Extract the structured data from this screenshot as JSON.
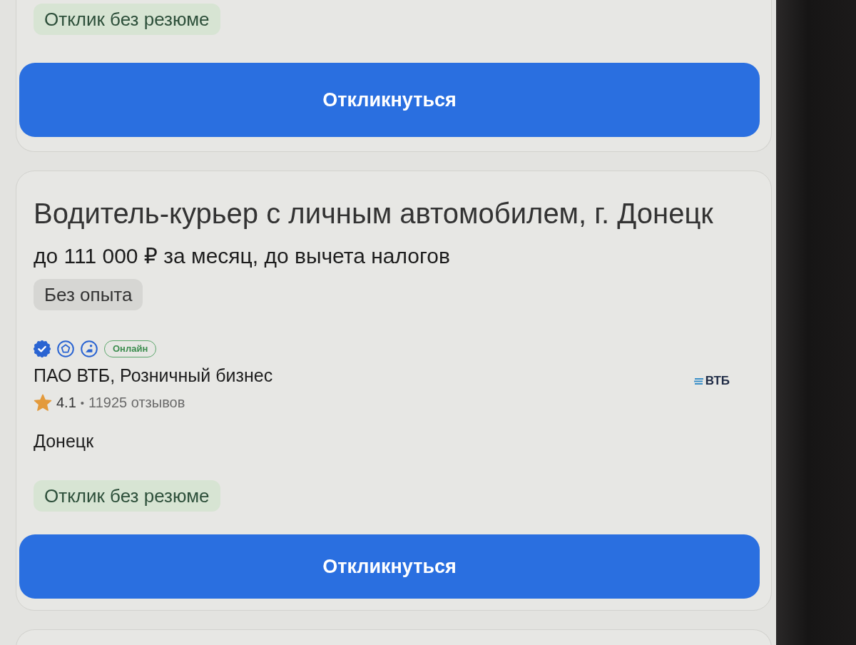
{
  "vacancies": [
    {
      "kind": "tail",
      "tags": [
        {
          "label": "Отклик без резюме"
        }
      ],
      "button": "Откликнуться"
    },
    {
      "kind": "full",
      "title": "Водитель-курьер с личным автомобилем, г. Донецк",
      "salary": "до 111 000 ₽ за месяц, до вычета налогов",
      "experience": "Без опыта",
      "badges": [
        {
          "kind": "verified"
        },
        {
          "kind": "award"
        },
        {
          "kind": "accredited"
        },
        {
          "kind": "online",
          "label": "Онлайн"
        }
      ],
      "company": "ПАО ВТБ, Розничный бизнес",
      "rating": "4.1",
      "separator": "•",
      "reviews": "11925 отзывов",
      "logo": "ВТБ",
      "city": "Донецк",
      "tags": [
        {
          "label": "Отклик без резюме"
        }
      ],
      "button": "Откликнуться"
    },
    {
      "kind": "head"
    }
  ]
}
